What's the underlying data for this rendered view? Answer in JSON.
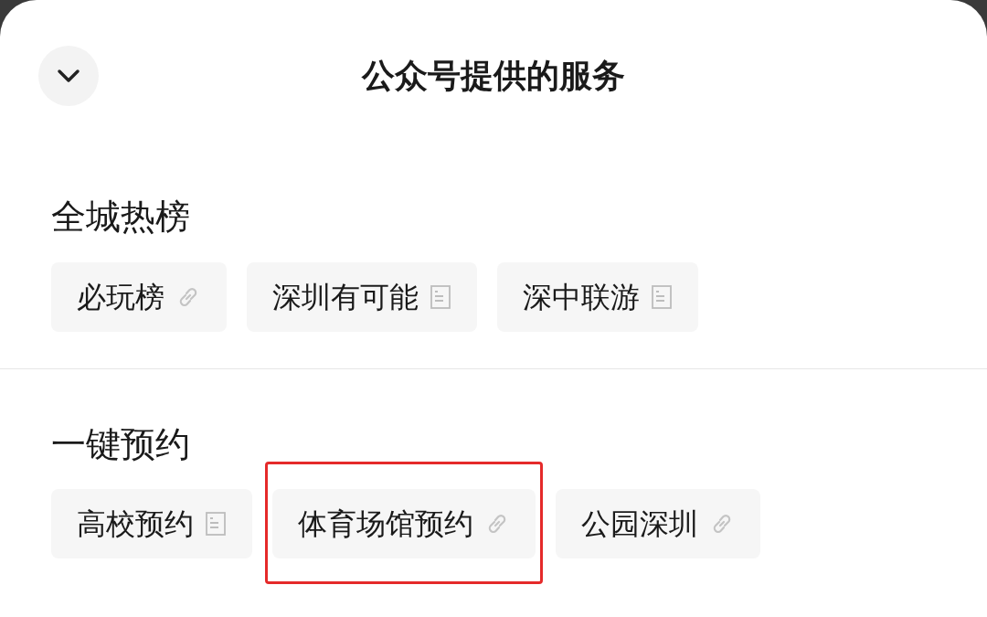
{
  "header": {
    "title": "公众号提供的服务"
  },
  "sections": [
    {
      "title": "全城热榜",
      "items": [
        {
          "label": "必玩榜",
          "kind": "link",
          "highlighted": false
        },
        {
          "label": "深圳有可能",
          "kind": "article",
          "highlighted": false
        },
        {
          "label": "深中联游",
          "kind": "article",
          "highlighted": false
        }
      ]
    },
    {
      "title": "一键预约",
      "items": [
        {
          "label": "高校预约",
          "kind": "article",
          "highlighted": false
        },
        {
          "label": "体育场馆预约",
          "kind": "link",
          "highlighted": true
        },
        {
          "label": "公园深圳",
          "kind": "link",
          "highlighted": false
        }
      ]
    }
  ]
}
